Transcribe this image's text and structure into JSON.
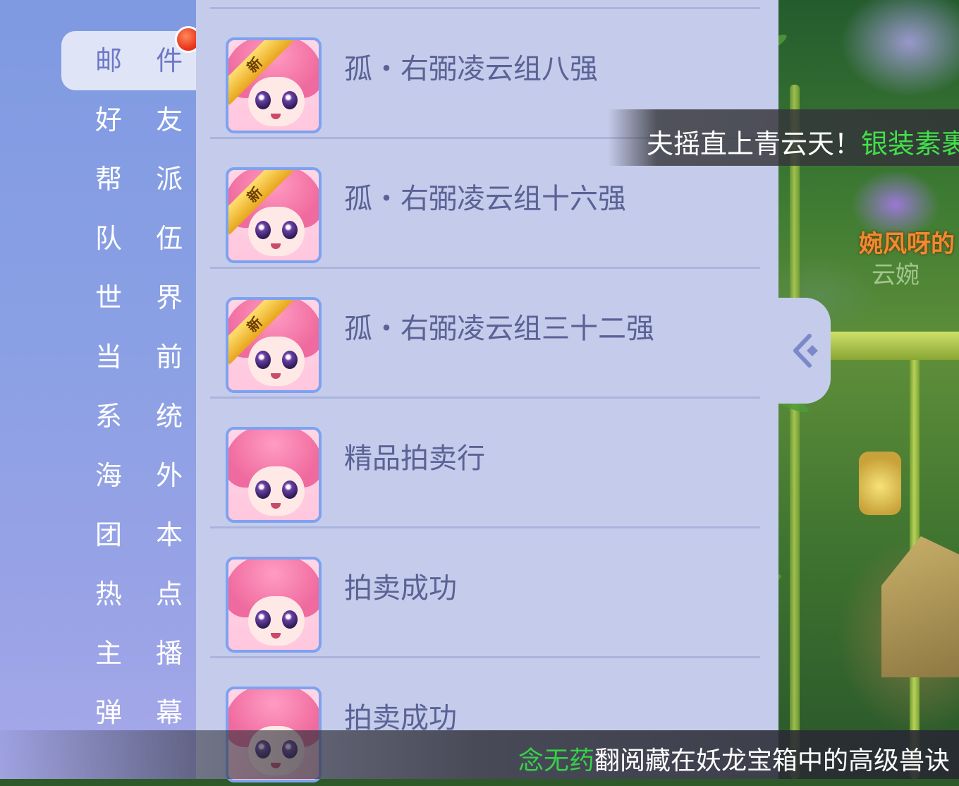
{
  "sidebar": {
    "categories": [
      {
        "label": "邮 件",
        "active": true
      },
      {
        "label": "好 友"
      },
      {
        "label": "帮 派"
      },
      {
        "label": "队 伍"
      },
      {
        "label": "世 界"
      },
      {
        "label": "当 前"
      },
      {
        "label": "系 统"
      },
      {
        "label": "海 外"
      },
      {
        "label": "团 本"
      },
      {
        "label": "热 点"
      },
      {
        "label": "主 播"
      },
      {
        "label": "弹 幕"
      }
    ]
  },
  "mail": {
    "items": [
      {
        "title": "孤・右弼凌云组八强",
        "new": true,
        "new_label": "新"
      },
      {
        "title": "孤・右弼凌云组十六强",
        "new": true,
        "new_label": "新"
      },
      {
        "title": "孤・右弼凌云组三十二强",
        "new": true,
        "new_label": "新"
      },
      {
        "title": "精品拍卖行",
        "new": false
      },
      {
        "title": "拍卖成功",
        "new": false
      },
      {
        "title": "拍卖成功",
        "new": false
      }
    ]
  },
  "banner": {
    "text": "夫摇直上青云天！",
    "highlight": "银装素裹"
  },
  "scene": {
    "name_text": "婉风呀的",
    "sub_text": "云婉"
  },
  "broadcast": {
    "player": "念无药",
    "message": "翻阅藏在妖龙宝箱中的高级兽诀"
  },
  "colors": {
    "sidebar_top": "#7f9ae2",
    "panel_bg": "#c5cceb",
    "title_text": "#5a6296",
    "highlight_green": "#41e04a",
    "badge_red": "#e8321a"
  }
}
